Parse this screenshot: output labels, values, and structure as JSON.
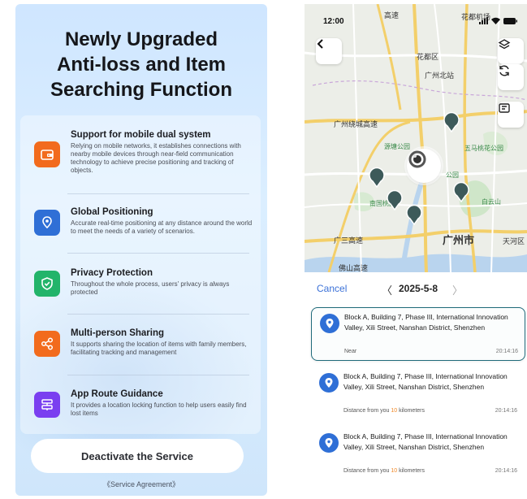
{
  "left": {
    "title_lines": [
      "Newly Upgraded",
      "Anti-loss and Item",
      "Searching Function"
    ],
    "features": [
      {
        "icon": "wallet-icon",
        "color": "#f26b1d",
        "title": "Support for mobile dual system",
        "desc": "Relying on mobile networks, it establishes connections with nearby mobile devices through near-field communication technology to achieve precise positioning and tracking of objects."
      },
      {
        "icon": "location-pin-icon",
        "color": "#2f6fd6",
        "title": "Global Positioning",
        "desc": "Accurate real-time positioning at any distance around the world to meet the needs of a variety of scenarios."
      },
      {
        "icon": "shield-check-icon",
        "color": "#22b46a",
        "title": "Privacy Protection",
        "desc": "Throughout the whole process, users' privacy is always protected"
      },
      {
        "icon": "share-icon",
        "color": "#f26b1d",
        "title": "Multi-person Sharing",
        "desc": "It supports sharing the location of items with family members, facilitating tracking and management"
      },
      {
        "icon": "route-sign-icon",
        "color": "#7a3ff0",
        "title": "App Route Guidance",
        "desc": "It provides a location locking function to help users easily find lost items"
      }
    ],
    "deactivate_label": "Deactivate the Service",
    "agreement_label": "《Service Agreement》"
  },
  "right": {
    "status_time": "12:00",
    "map_labels": {
      "huadu": "花都区",
      "guangzhou_north": "广州北站",
      "huadu_airport": "花都机场",
      "gao_su_top": "高速",
      "expressway": "广州绕城高速",
      "yuanyang_park": "源塘公园",
      "wuyun_park": "五马桃花公园",
      "park": "公园",
      "nanguo": "南国桃园",
      "baiyun": "白云山",
      "guangsan": "广三高速",
      "guangzhou_city": "广州市",
      "tianhe": "天河区",
      "foshan": "佛山",
      "side": "佛山高速"
    },
    "date_bar": {
      "cancel": "Cancel",
      "prev": "〈",
      "date": "2025-5-8",
      "next": "〉"
    },
    "records": [
      {
        "address": "Block A, Building 7, Phase III, International Innovation Valley, Xili Street, Nanshan District, Shenzhen",
        "meta_prefix": "Near",
        "meta_num": "",
        "meta_suffix": "",
        "time": "20:14:16"
      },
      {
        "address": "Block A, Building 7, Phase III, International Innovation Valley, Xili Street, Nanshan District, Shenzhen",
        "meta_prefix": "Distance from you ",
        "meta_num": "10",
        "meta_suffix": " kilometers",
        "time": "20:14:16"
      },
      {
        "address": "Block A, Building 7, Phase III, International Innovation Valley, Xili Street, Nanshan District, Shenzhen",
        "meta_prefix": "Distance from you ",
        "meta_num": "10",
        "meta_suffix": " kilometers",
        "time": "20:14:16"
      }
    ]
  }
}
